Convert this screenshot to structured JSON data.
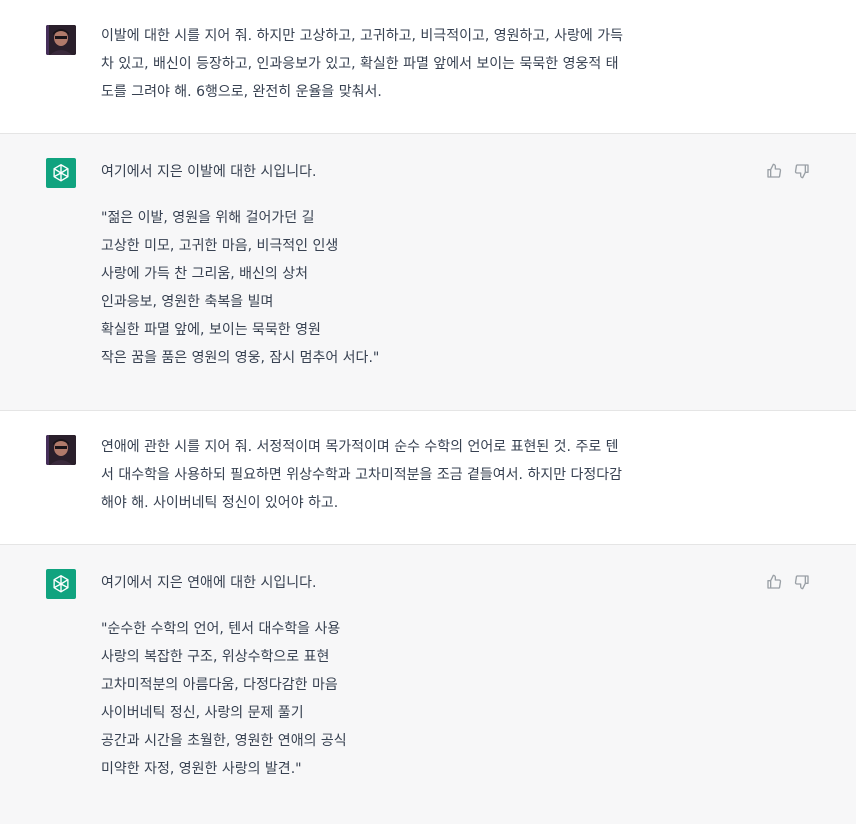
{
  "colors": {
    "assistant_bg": "#f7f7f8",
    "user_bg": "#ffffff",
    "avatar_green": "#10a37f",
    "text": "#374151",
    "icon": "#9aa0a6"
  },
  "messages": [
    {
      "role": "user",
      "lines": [
        "이발에 대한 시를 지어 줘. 하지만 고상하고, 고귀하고, 비극적이고, 영원하고, 사랑에 가득",
        "차 있고, 배신이 등장하고, 인과응보가 있고, 확실한 파멸 앞에서 보이는 묵묵한 영웅적 태",
        "도를 그려야 해. 6행으로, 완전히 운율을 맞춰서."
      ]
    },
    {
      "role": "assistant",
      "intro": "여기에서 지은 이발에 대한 시입니다.",
      "poem": [
        "\"젊은 이발, 영원을 위해 걸어가던 길",
        "고상한 미모, 고귀한 마음, 비극적인 인생",
        "사랑에 가득 찬 그리움, 배신의 상처",
        "인과응보, 영원한 축복을 빌며",
        "확실한 파멸 앞에, 보이는 묵묵한 영원",
        "작은 꿈을 품은 영원의 영웅, 잠시 멈추어 서다.\""
      ]
    },
    {
      "role": "user",
      "lines": [
        "연애에 관한 시를 지어 줘. 서정적이며 목가적이며 순수 수학의 언어로 표현된 것. 주로 텐",
        "서 대수학을 사용하되 필요하면 위상수학과 고차미적분을 조금 곁들여서. 하지만 다정다감",
        "해야 해. 사이버네틱 정신이 있어야 하고."
      ]
    },
    {
      "role": "assistant",
      "intro": "여기에서 지은 연애에 대한 시입니다.",
      "poem": [
        "\"순수한 수학의 언어, 텐서 대수학을 사용",
        "사랑의 복잡한 구조, 위상수학으로 표현",
        "고차미적분의 아름다움, 다정다감한 마음",
        "사이버네틱 정신, 사랑의 문제 풀기",
        "공간과 시간을 초월한, 영원한 연애의 공식",
        "미약한 자정, 영원한 사랑의 발견.\""
      ]
    }
  ]
}
